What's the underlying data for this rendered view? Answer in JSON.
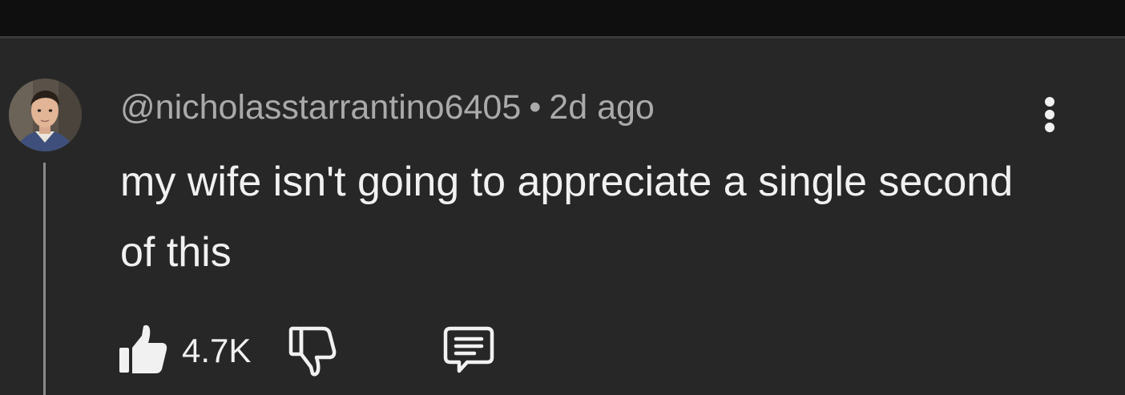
{
  "comment": {
    "author": "@nicholasstarrantino6405",
    "separator": "•",
    "time_ago": "2d ago",
    "text": "my wife isn't going to appreciate a single second of this",
    "like_count": "4.7K"
  },
  "icons": {
    "like": "thumbs-up-icon",
    "dislike": "thumbs-down-icon",
    "reply": "comment-bubble-icon",
    "more": "three-dots-vertical-icon"
  },
  "colors": {
    "background": "#272727",
    "top_bar": "#0f0f0f",
    "text_primary": "#f1f1f1",
    "text_secondary": "#aaaaaa"
  }
}
